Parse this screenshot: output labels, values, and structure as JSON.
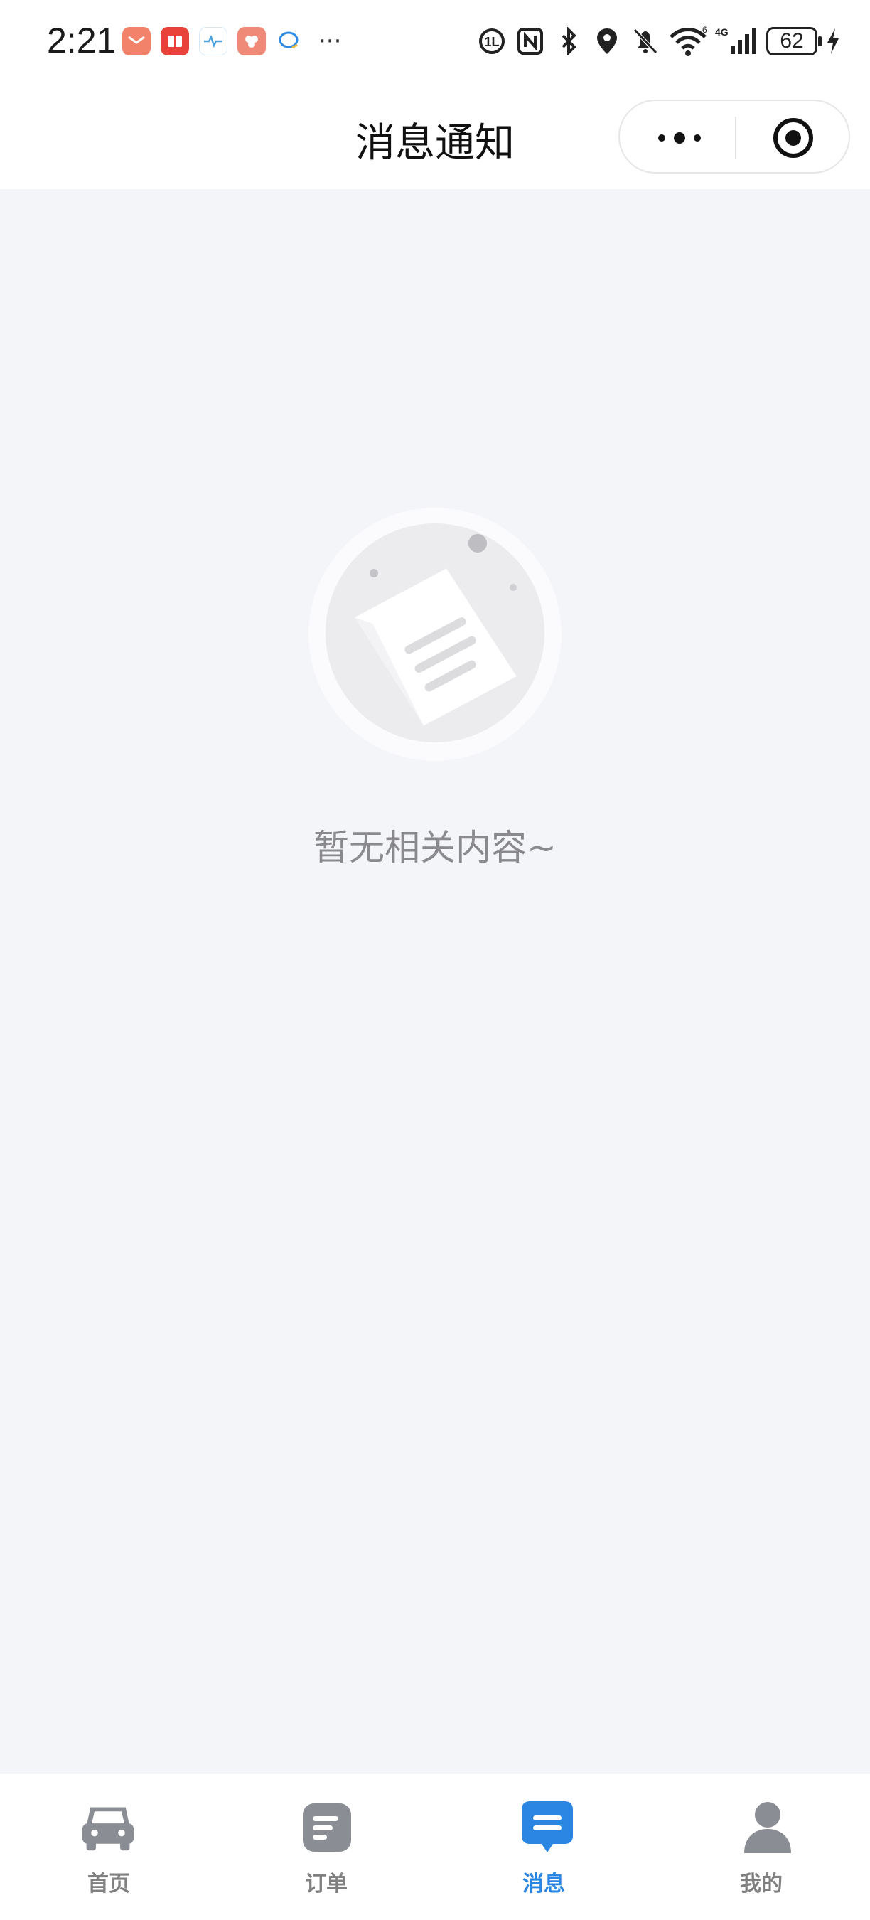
{
  "status_bar": {
    "time": "2:21",
    "battery": "62",
    "network": "4G",
    "app_icons": [
      "mail-app-icon",
      "reader-app-icon",
      "health-app-icon",
      "gallery-app-icon",
      "chat-app-icon"
    ],
    "more": "···"
  },
  "header": {
    "title": "消息通知"
  },
  "empty": {
    "message": "暂无相关内容~"
  },
  "tabs": [
    {
      "label": "首页",
      "icon": "car-icon",
      "active": false
    },
    {
      "label": "订单",
      "icon": "order-list-icon",
      "active": false
    },
    {
      "label": "消息",
      "icon": "message-icon",
      "active": true
    },
    {
      "label": "我的",
      "icon": "person-icon",
      "active": false
    }
  ],
  "colors": {
    "accent": "#2a86e2",
    "inactive": "#808080",
    "background": "#f4f5f9"
  }
}
